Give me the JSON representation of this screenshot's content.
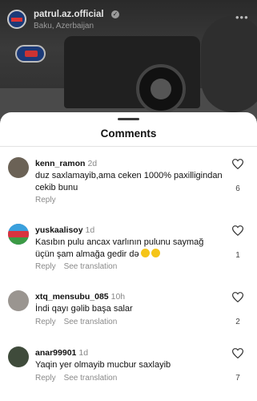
{
  "post": {
    "username": "patrul.az.official",
    "location": "Baku, Azerbaijan"
  },
  "sheet": {
    "title": "Comments"
  },
  "comments": [
    {
      "username": "kenn_ramon",
      "time": "2d",
      "text": "duz saxlamayib,ama ceken 1000% paxilligindan cekib bunu",
      "reply": "Reply",
      "likes": "6",
      "avatar_color": "#6b6256"
    },
    {
      "username": "yuskaalisoy",
      "time": "1d",
      "text": "Kasıbın pulu ancax varlının pulunu saymağ üçün şam almağa gedir də",
      "reply": "Reply",
      "see_translation": "See translation",
      "likes": "1",
      "avatar_color": "#2f6fb0"
    },
    {
      "username": "xtq_mensubu_085",
      "time": "10h",
      "text": "İndi qayı gəlib başa salar",
      "reply": "Reply",
      "see_translation": "See translation",
      "likes": "2",
      "avatar_color": "#9a9590"
    },
    {
      "username": "anar99901",
      "time": "1d",
      "text": "Yaqin yer olmayib mucbur saxlayib",
      "reply": "Reply",
      "see_translation": "See translation",
      "likes": "7",
      "avatar_color": "#3f4b3b"
    }
  ]
}
